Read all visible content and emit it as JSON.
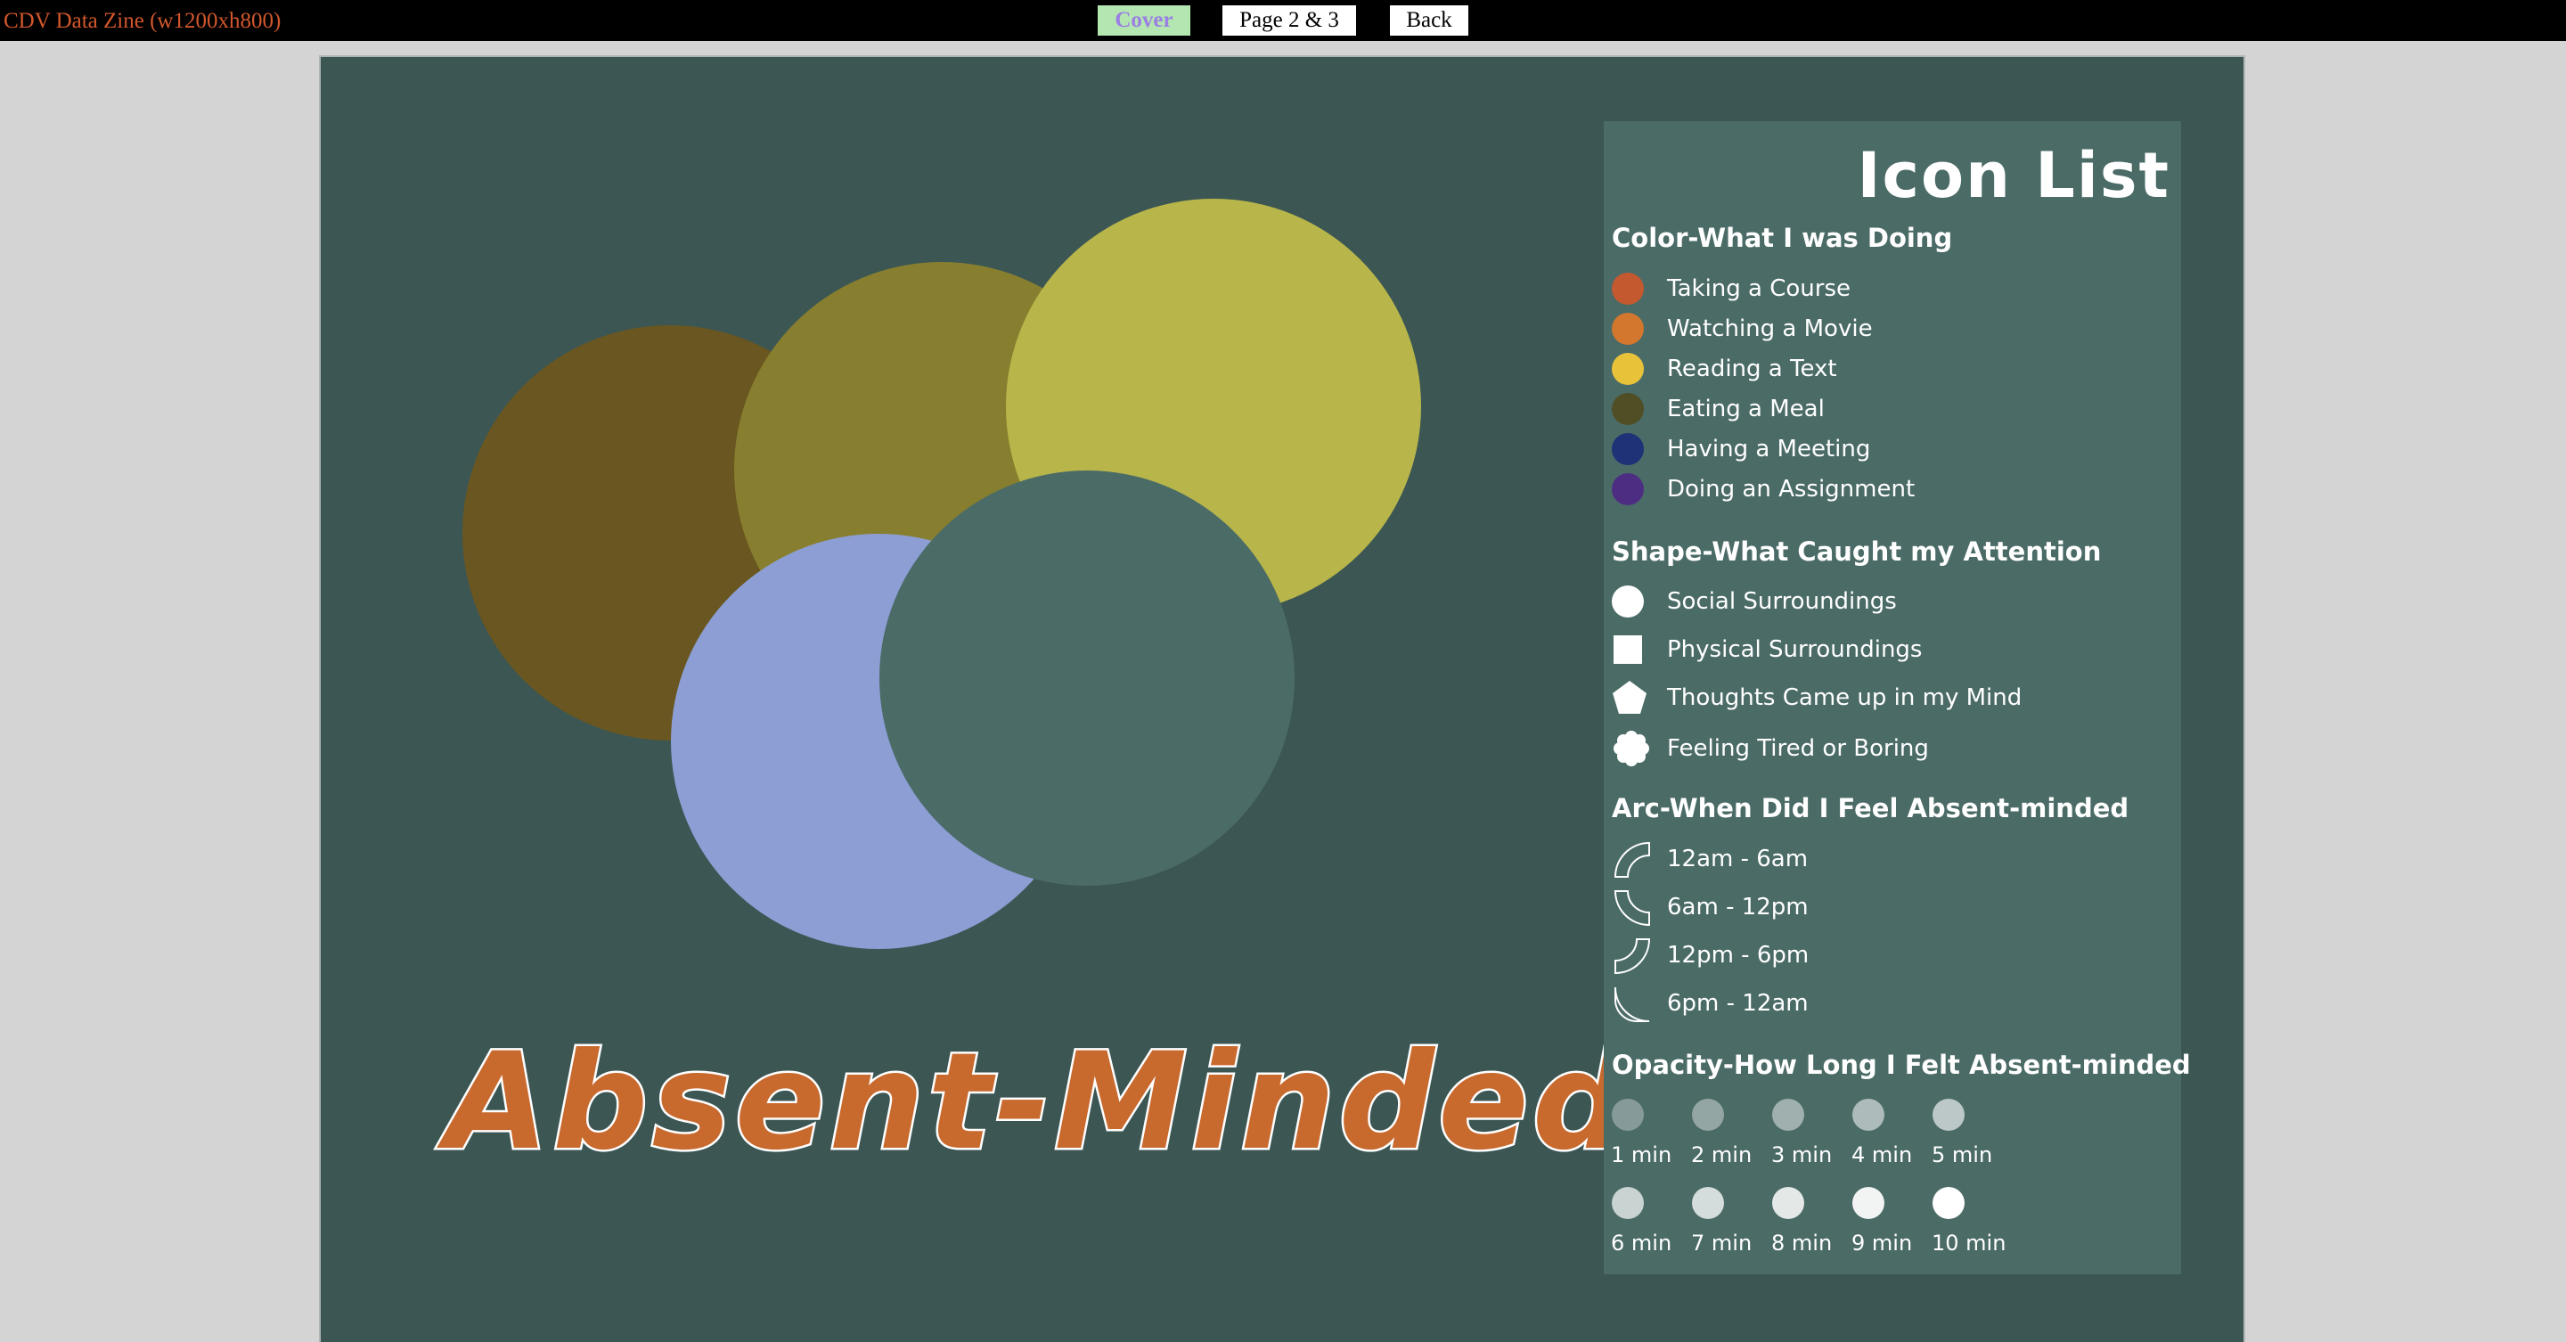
{
  "topbar": {
    "app_title": "CDV Data Zine (w1200xh800)",
    "nav": {
      "cover": "Cover",
      "pages": "Page 2 & 3",
      "back": "Back"
    }
  },
  "zine": {
    "cover_title": "Absent-Minded",
    "circle_colors": [
      "#6a5620",
      "#877f2f",
      "#b8b64a",
      "#8c9ed4",
      "#4b6b67"
    ]
  },
  "legend": {
    "title": "Icon List",
    "color_section": {
      "heading": "Color-What I was Doing",
      "items": [
        {
          "label": "Taking a Course",
          "color": "#c4582f"
        },
        {
          "label": "Watching a Movie",
          "color": "#d2772d"
        },
        {
          "label": "Reading a Text",
          "color": "#e8c33a"
        },
        {
          "label": "Eating a Meal",
          "color": "#4f4e25"
        },
        {
          "label": "Having a Meeting",
          "color": "#1f3177"
        },
        {
          "label": "Doing an Assignment",
          "color": "#4d2d82"
        }
      ]
    },
    "shape_section": {
      "heading": "Shape-What Caught my Attention",
      "items": [
        {
          "label": "Social Surroundings",
          "icon": "circle-icon"
        },
        {
          "label": "Physical Surroundings",
          "icon": "square-icon"
        },
        {
          "label": "Thoughts Came up in my Mind",
          "icon": "pentagon-icon"
        },
        {
          "label": "Feeling Tired or Boring",
          "icon": "flower-icon"
        }
      ]
    },
    "arc_section": {
      "heading": "Arc-When Did I Feel Absent-minded",
      "items": [
        {
          "label": "12am - 6am",
          "icon": "arc-top-left-icon"
        },
        {
          "label": "6am - 12pm",
          "icon": "arc-bottom-left-icon"
        },
        {
          "label": "12pm - 6pm",
          "icon": "arc-bottom-left-icon"
        },
        {
          "label": "6pm - 12am",
          "icon": "arc-left-icon"
        }
      ]
    },
    "opacity_section": {
      "heading": "Opacity-How Long I Felt Absent-minded",
      "items": [
        {
          "label": "1 min",
          "opacity": 0.1
        },
        {
          "label": "2 min",
          "opacity": 0.2
        },
        {
          "label": "3 min",
          "opacity": 0.3
        },
        {
          "label": "4 min",
          "opacity": 0.4
        },
        {
          "label": "5 min",
          "opacity": 0.5
        },
        {
          "label": "6 min",
          "opacity": 0.6
        },
        {
          "label": "7 min",
          "opacity": 0.7
        },
        {
          "label": "8 min",
          "opacity": 0.8
        },
        {
          "label": "9 min",
          "opacity": 0.9
        },
        {
          "label": "10 min",
          "opacity": 1.0
        }
      ]
    }
  }
}
